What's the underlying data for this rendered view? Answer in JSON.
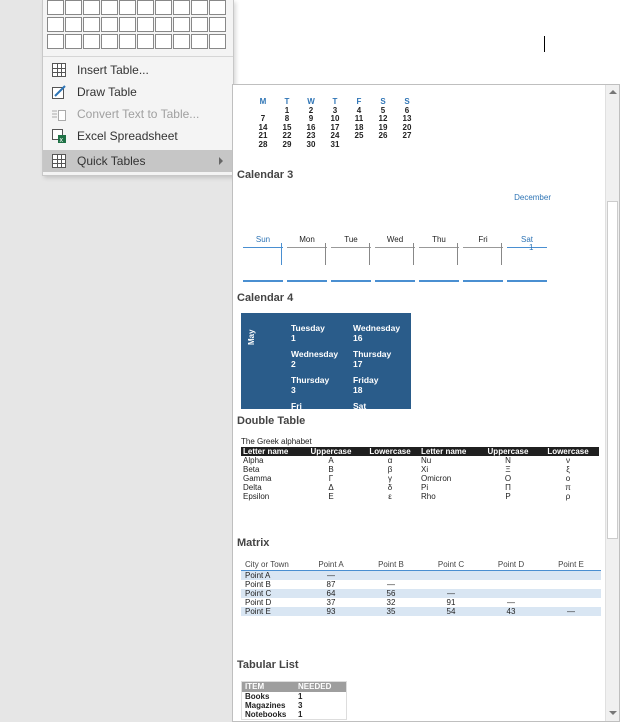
{
  "menu": {
    "grid_rows": 3,
    "grid_cols": 10,
    "items": [
      {
        "label": "Insert Table...",
        "icon": "insert-table-icon",
        "disabled": false
      },
      {
        "label": "Draw Table",
        "icon": "draw-table-icon",
        "disabled": false
      },
      {
        "label": "Convert Text to Table...",
        "icon": "convert-text-icon",
        "disabled": true
      },
      {
        "label": "Excel Spreadsheet",
        "icon": "excel-icon",
        "disabled": false
      },
      {
        "label": "Quick Tables",
        "icon": "quick-tables-icon",
        "disabled": false,
        "active": true
      }
    ]
  },
  "gallery": {
    "mini_calendar": {
      "headers": [
        "M",
        "T",
        "W",
        "T",
        "F",
        "S",
        "S"
      ],
      "rows": [
        [
          "",
          "1",
          "2",
          "3",
          "4",
          "5",
          "6"
        ],
        [
          "7",
          "8",
          "9",
          "10",
          "11",
          "12",
          "13"
        ],
        [
          "14",
          "15",
          "16",
          "17",
          "18",
          "19",
          "20"
        ],
        [
          "21",
          "22",
          "23",
          "24",
          "25",
          "26",
          "27"
        ],
        [
          "28",
          "29",
          "30",
          "31",
          "",
          "",
          ""
        ]
      ]
    },
    "calendar3": {
      "title": "Calendar 3",
      "month": "December",
      "days": [
        "Sun",
        "Mon",
        "Tue",
        "Wed",
        "Thu",
        "Fri",
        "Sat"
      ],
      "sat_number": "1"
    },
    "calendar4": {
      "title": "Calendar 4",
      "month": "May",
      "rows": [
        [
          {
            "day": "Tuesday",
            "num": "1"
          },
          {
            "day": "Wednesday",
            "num": "16"
          }
        ],
        [
          {
            "day": "Wednesday",
            "num": "2"
          },
          {
            "day": "Thursday",
            "num": "17"
          }
        ],
        [
          {
            "day": "Thursday",
            "num": "3"
          },
          {
            "day": "Friday",
            "num": "18"
          }
        ],
        [
          {
            "day": "Fri",
            "num": ""
          },
          {
            "day": "Sat",
            "num": ""
          }
        ]
      ]
    },
    "double_table": {
      "title": "Double Table",
      "caption": "The Greek alphabet",
      "headers": [
        "Letter name",
        "Uppercase",
        "Lowercase",
        "Letter name",
        "Uppercase",
        "Lowercase"
      ],
      "rows": [
        [
          "Alpha",
          "Α",
          "α",
          "Nu",
          "Ν",
          "ν"
        ],
        [
          "Beta",
          "Β",
          "β",
          "Xi",
          "Ξ",
          "ξ"
        ],
        [
          "Gamma",
          "Γ",
          "γ",
          "Omicron",
          "Ο",
          "ο"
        ],
        [
          "Delta",
          "Δ",
          "δ",
          "Pi",
          "Π",
          "π"
        ],
        [
          "Epsilon",
          "Ε",
          "ε",
          "Rho",
          "Ρ",
          "ρ"
        ]
      ]
    },
    "matrix": {
      "title": "Matrix",
      "headers": [
        "City or Town",
        "Point A",
        "Point B",
        "Point C",
        "Point D",
        "Point E"
      ],
      "rows": [
        [
          "Point A",
          "—",
          "",
          "",
          "",
          ""
        ],
        [
          "Point B",
          "87",
          "—",
          "",
          "",
          ""
        ],
        [
          "Point C",
          "64",
          "56",
          "—",
          "",
          ""
        ],
        [
          "Point D",
          "37",
          "32",
          "91",
          "—",
          ""
        ],
        [
          "Point E",
          "93",
          "35",
          "54",
          "43",
          "—"
        ]
      ]
    },
    "tabular_list": {
      "title": "Tabular List",
      "headers": [
        "ITEM",
        "NEEDED"
      ],
      "rows": [
        [
          "Books",
          "1"
        ],
        [
          "Magazines",
          "3"
        ],
        [
          "Notebooks",
          "1"
        ]
      ]
    }
  }
}
